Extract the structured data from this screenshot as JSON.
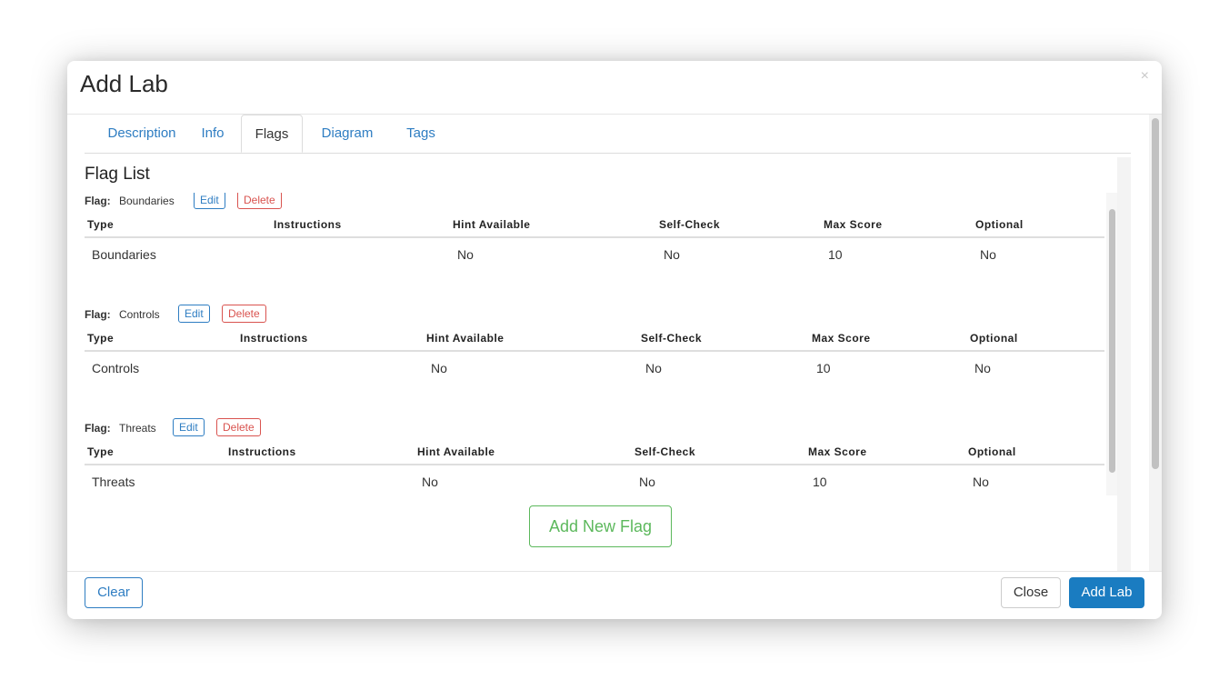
{
  "modal": {
    "title": "Add Lab",
    "close_glyph": "×"
  },
  "tabs": [
    {
      "label": "Description"
    },
    {
      "label": "Info"
    },
    {
      "label": "Flags"
    },
    {
      "label": "Diagram"
    },
    {
      "label": "Tags"
    }
  ],
  "active_tab": "Flags",
  "flag_list": {
    "title": "Flag List",
    "flag_label": "Flag:",
    "edit_label": "Edit",
    "delete_label": "Delete",
    "columns": [
      "Type",
      "Instructions",
      "Hint Available",
      "Self-Check",
      "Max Score",
      "Optional"
    ],
    "flags": [
      {
        "name": "Boundaries",
        "type": "Boundaries",
        "instructions": "",
        "hint": "No",
        "self_check": "No",
        "max_score": "10",
        "optional": "No"
      },
      {
        "name": "Controls",
        "type": "Controls",
        "instructions": "",
        "hint": "No",
        "self_check": "No",
        "max_score": "10",
        "optional": "No"
      },
      {
        "name": "Threats",
        "type": "Threats",
        "instructions": "",
        "hint": "No",
        "self_check": "No",
        "max_score": "10",
        "optional": "No"
      }
    ],
    "add_button": "Add New Flag"
  },
  "footer": {
    "clear_label": "Clear",
    "close_label": "Close",
    "add_label": "Add Lab"
  },
  "colors": {
    "primary": "#1a7cc1",
    "link": "#2e7dc2",
    "danger": "#d9534f",
    "success": "#5cb85c"
  }
}
